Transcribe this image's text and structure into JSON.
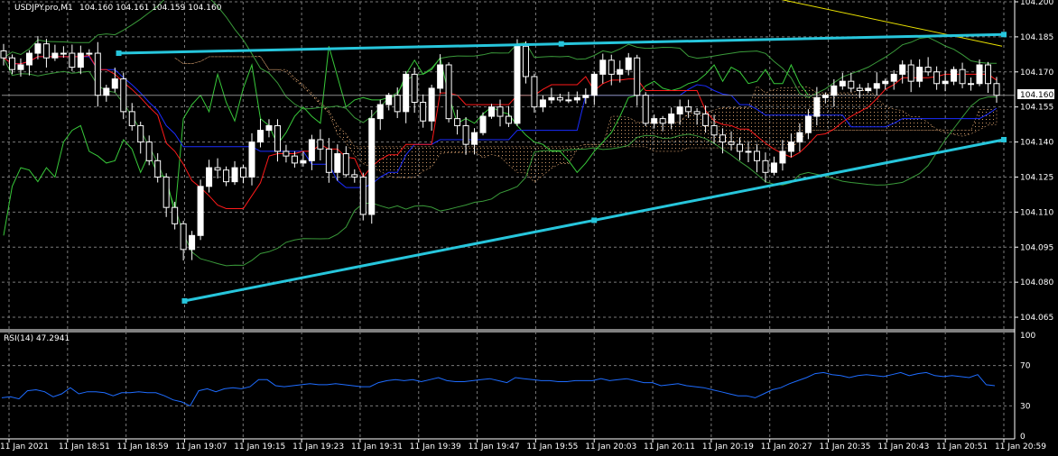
{
  "header": {
    "symbol": "USDJPY.pro,M1",
    "ohlc": "104.160 104.161 104.159 104.160"
  },
  "price_marker": "104.160",
  "colors": {
    "background": "#000000",
    "grid": "#7a7a7a",
    "candle": "#ffffff",
    "trendline": "#27c6dc",
    "rsi_line": "#1e6cff",
    "tenkan": "#ff1a1a",
    "kijun": "#1a2cff",
    "chikou": "#38c93a",
    "bollinger": "#3a9a3a",
    "cloud": "#cf9a6a",
    "yellow_line": "#e8e000"
  },
  "chart_data": [
    {
      "type": "candlestick",
      "title": "USDJPY.pro,M1",
      "xlabel": "",
      "ylabel": "",
      "ylim": [
        104.06,
        104.2
      ],
      "y_ticks": [
        "104.200",
        "104.185",
        "104.170",
        "104.155",
        "104.140",
        "104.125",
        "104.110",
        "104.095",
        "104.080",
        "104.065"
      ],
      "x_ticks": [
        "11 Jan 2021",
        "11 Jan 18:51",
        "11 Jan 18:59",
        "11 Jan 19:07",
        "11 Jan 19:15",
        "11 Jan 19:23",
        "11 Jan 19:31",
        "11 Jan 19:39",
        "11 Jan 19:47",
        "11 Jan 19:55",
        "11 Jan 20:03",
        "11 Jan 20:11",
        "11 Jan 20:19",
        "11 Jan 20:27",
        "11 Jan 20:35",
        "11 Jan 20:43",
        "11 Jan 20:51",
        "11 Jan 20:59"
      ],
      "close_path": [
        104.176,
        104.171,
        104.173,
        104.178,
        104.182,
        104.176,
        104.178,
        104.178,
        104.172,
        104.178,
        104.178,
        104.16,
        104.163,
        104.167,
        104.153,
        104.147,
        104.14,
        104.132,
        104.125,
        104.112,
        104.105,
        104.094,
        104.1,
        104.121,
        104.129,
        104.128,
        104.123,
        104.129,
        104.125,
        104.14,
        104.145,
        104.147,
        104.136,
        104.134,
        104.131,
        104.132,
        104.141,
        104.137,
        104.127,
        104.135,
        104.126,
        104.125,
        104.109,
        104.15,
        104.156,
        104.16,
        104.153,
        104.169,
        104.157,
        104.149,
        104.163,
        104.173,
        104.15,
        104.147,
        104.139,
        104.144,
        104.151,
        104.155,
        104.151,
        104.148,
        104.181,
        104.168,
        104.155,
        104.158,
        104.159,
        104.158,
        104.158,
        104.159,
        104.16,
        104.169,
        104.175,
        104.169,
        104.171,
        104.176,
        104.16,
        104.148,
        104.15,
        104.148,
        104.152,
        104.155,
        104.153,
        104.152,
        104.147,
        104.143,
        104.14,
        104.139,
        104.136,
        104.136,
        104.132,
        104.127,
        104.131,
        104.136,
        104.14,
        104.144,
        104.151,
        104.159,
        104.16,
        104.164,
        104.166,
        104.163,
        104.162,
        104.163,
        104.165,
        104.166,
        104.169,
        104.173,
        104.166,
        104.172,
        104.17,
        104.165,
        104.166,
        104.171,
        104.165,
        104.165,
        104.173,
        104.165,
        104.16
      ],
      "trendlines": [
        {
          "from": [
            "11 Jan 18:58",
            104.178
          ],
          "to": [
            "11 Jan 20:59",
            104.186
          ]
        },
        {
          "from": [
            "11 Jan 19:07",
            104.072
          ],
          "to": [
            "11 Jan 20:59",
            104.141
          ]
        }
      ],
      "current_price": 104.16
    },
    {
      "type": "line",
      "title": "RSI(14) 47.2941",
      "ylim": [
        0,
        100
      ],
      "y_ticks": [
        "100",
        "70",
        "30",
        "0"
      ],
      "values": [
        38,
        39,
        37,
        45,
        46,
        44,
        39,
        42,
        48,
        42,
        44,
        44,
        43,
        40,
        43,
        43,
        44,
        43,
        43,
        40,
        36,
        34,
        30,
        45,
        47,
        44,
        47,
        48,
        47,
        49,
        56,
        56,
        50,
        49,
        50,
        51,
        52,
        51,
        51,
        52,
        51,
        50,
        49,
        49,
        53,
        55,
        56,
        55,
        56,
        54,
        56,
        58,
        55,
        54,
        54,
        55,
        56,
        57,
        55,
        53,
        58,
        57,
        56,
        55,
        55,
        54,
        54,
        55,
        55,
        55,
        57,
        55,
        56,
        57,
        55,
        53,
        53,
        50,
        51,
        52,
        50,
        49,
        48,
        46,
        44,
        42,
        40,
        40,
        38,
        42,
        46,
        48,
        52,
        55,
        58,
        62,
        63,
        61,
        60,
        58,
        60,
        61,
        60,
        59,
        61,
        63,
        60,
        62,
        63,
        60,
        59,
        60,
        59,
        58,
        61,
        51,
        50
      ]
    }
  ]
}
